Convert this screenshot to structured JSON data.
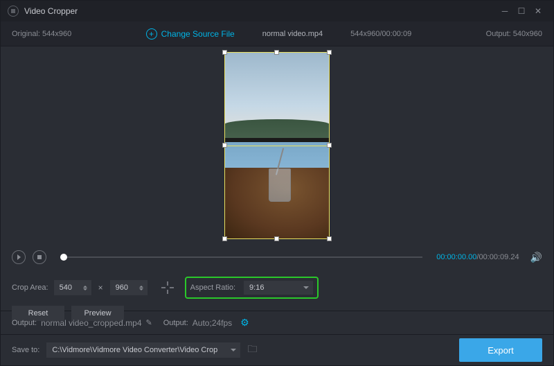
{
  "app": {
    "title": "Video Cropper"
  },
  "toolbar": {
    "original_label": "Original:",
    "original_dim": "544x960",
    "change_source": "Change Source File",
    "filename": "normal video.mp4",
    "meta": "544x960/00:00:09",
    "output_label": "Output:",
    "output_dim": "540x960"
  },
  "playback": {
    "current": "00:00:00.00",
    "total": "/00:00:09.24"
  },
  "crop": {
    "area_label": "Crop Area:",
    "width": "540",
    "height": "960",
    "aspect_label": "Aspect Ratio:",
    "aspect_value": "9:16",
    "reset": "Reset",
    "preview": "Preview"
  },
  "output": {
    "label1": "Output:",
    "filename": "normal video_cropped.mp4",
    "label2": "Output:",
    "settings": "Auto;24fps"
  },
  "save": {
    "label": "Save to:",
    "path": "C:\\Vidmore\\Vidmore Video Converter\\Video Crop"
  },
  "export": {
    "label": "Export"
  },
  "colors": {
    "accent": "#00b4e6",
    "highlight": "#2ac82a",
    "export": "#3aa7e8"
  }
}
